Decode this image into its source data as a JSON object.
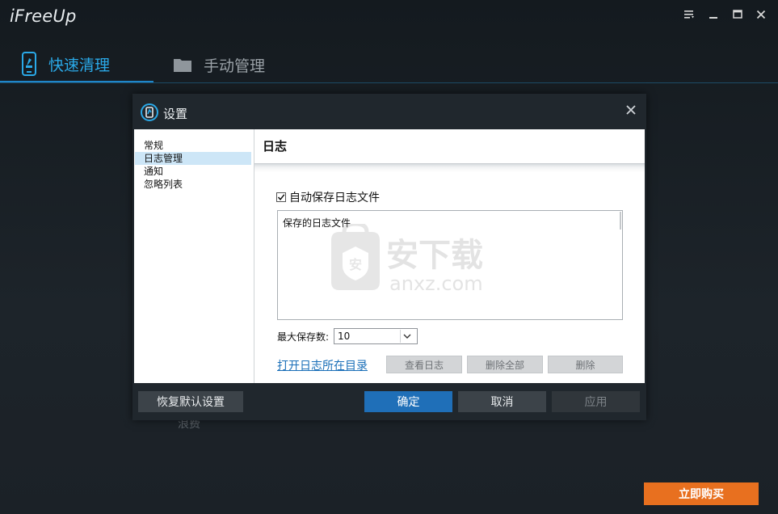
{
  "app": {
    "title": "iFreeUp",
    "window_controls": [
      "menu-icon",
      "minimize-icon",
      "maximize-icon",
      "close-icon"
    ]
  },
  "tabs": [
    {
      "label": "快速清理",
      "icon": "phone-clean-icon",
      "active": true
    },
    {
      "label": "手动管理",
      "icon": "folder-icon",
      "active": false
    }
  ],
  "background_text": "浪费",
  "buy_button": "立即购买",
  "dialog": {
    "title": "设置",
    "sidebar": [
      {
        "label": "常规",
        "selected": false
      },
      {
        "label": "日志管理",
        "selected": true
      },
      {
        "label": "通知",
        "selected": false
      },
      {
        "label": "忽略列表",
        "selected": false
      }
    ],
    "content": {
      "title": "日志",
      "auto_save_label": "自动保存日志文件",
      "auto_save_checked": true,
      "log_box_header": "保存的日志文件",
      "max_save_label": "最大保存数:",
      "max_save_value": "10",
      "open_dir_link": "打开日志所在目录",
      "view_log_button": "查看日志",
      "delete_all_button": "删除全部",
      "delete_button": "删除"
    },
    "footer": {
      "reset_button": "恢复默认设置",
      "ok_button": "确定",
      "cancel_button": "取消",
      "apply_button": "应用"
    }
  },
  "watermark": {
    "cn": "安下载",
    "url": "anxz.com"
  },
  "colors": {
    "accent": "#2aa9e8",
    "primary_button": "#1f6fb8",
    "buy": "#e8701f",
    "selection": "#cde6f7"
  }
}
